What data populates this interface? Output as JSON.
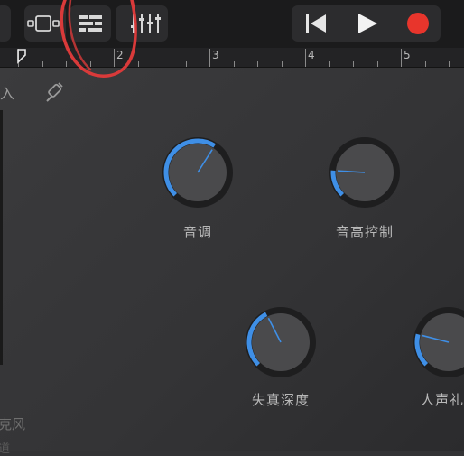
{
  "toolbar": {
    "buttons": [
      {
        "icon": "browser-view-icon"
      },
      {
        "icon": "tracks-view-icon"
      },
      {
        "icon": "mixer-icon"
      },
      {
        "icon": "rewind-icon"
      },
      {
        "icon": "play-icon"
      },
      {
        "icon": "record-icon"
      }
    ],
    "record_color": "#e8352c"
  },
  "ruler": {
    "markers": [
      "2",
      "3",
      "4",
      "5"
    ]
  },
  "controls_panel": {
    "input_label": "入",
    "cable_icon": "input-cable-icon",
    "knobs": [
      {
        "label": "音调",
        "value": 0.62
      },
      {
        "label": "音高控制",
        "value": 0.18
      },
      {
        "label": "失真深度",
        "value": 0.4
      },
      {
        "label": "人声礼",
        "value": 0.22
      }
    ],
    "accent_color": "#3f8fe6",
    "bottom_left_label": "克风",
    "bottom_left_label2": "道"
  }
}
